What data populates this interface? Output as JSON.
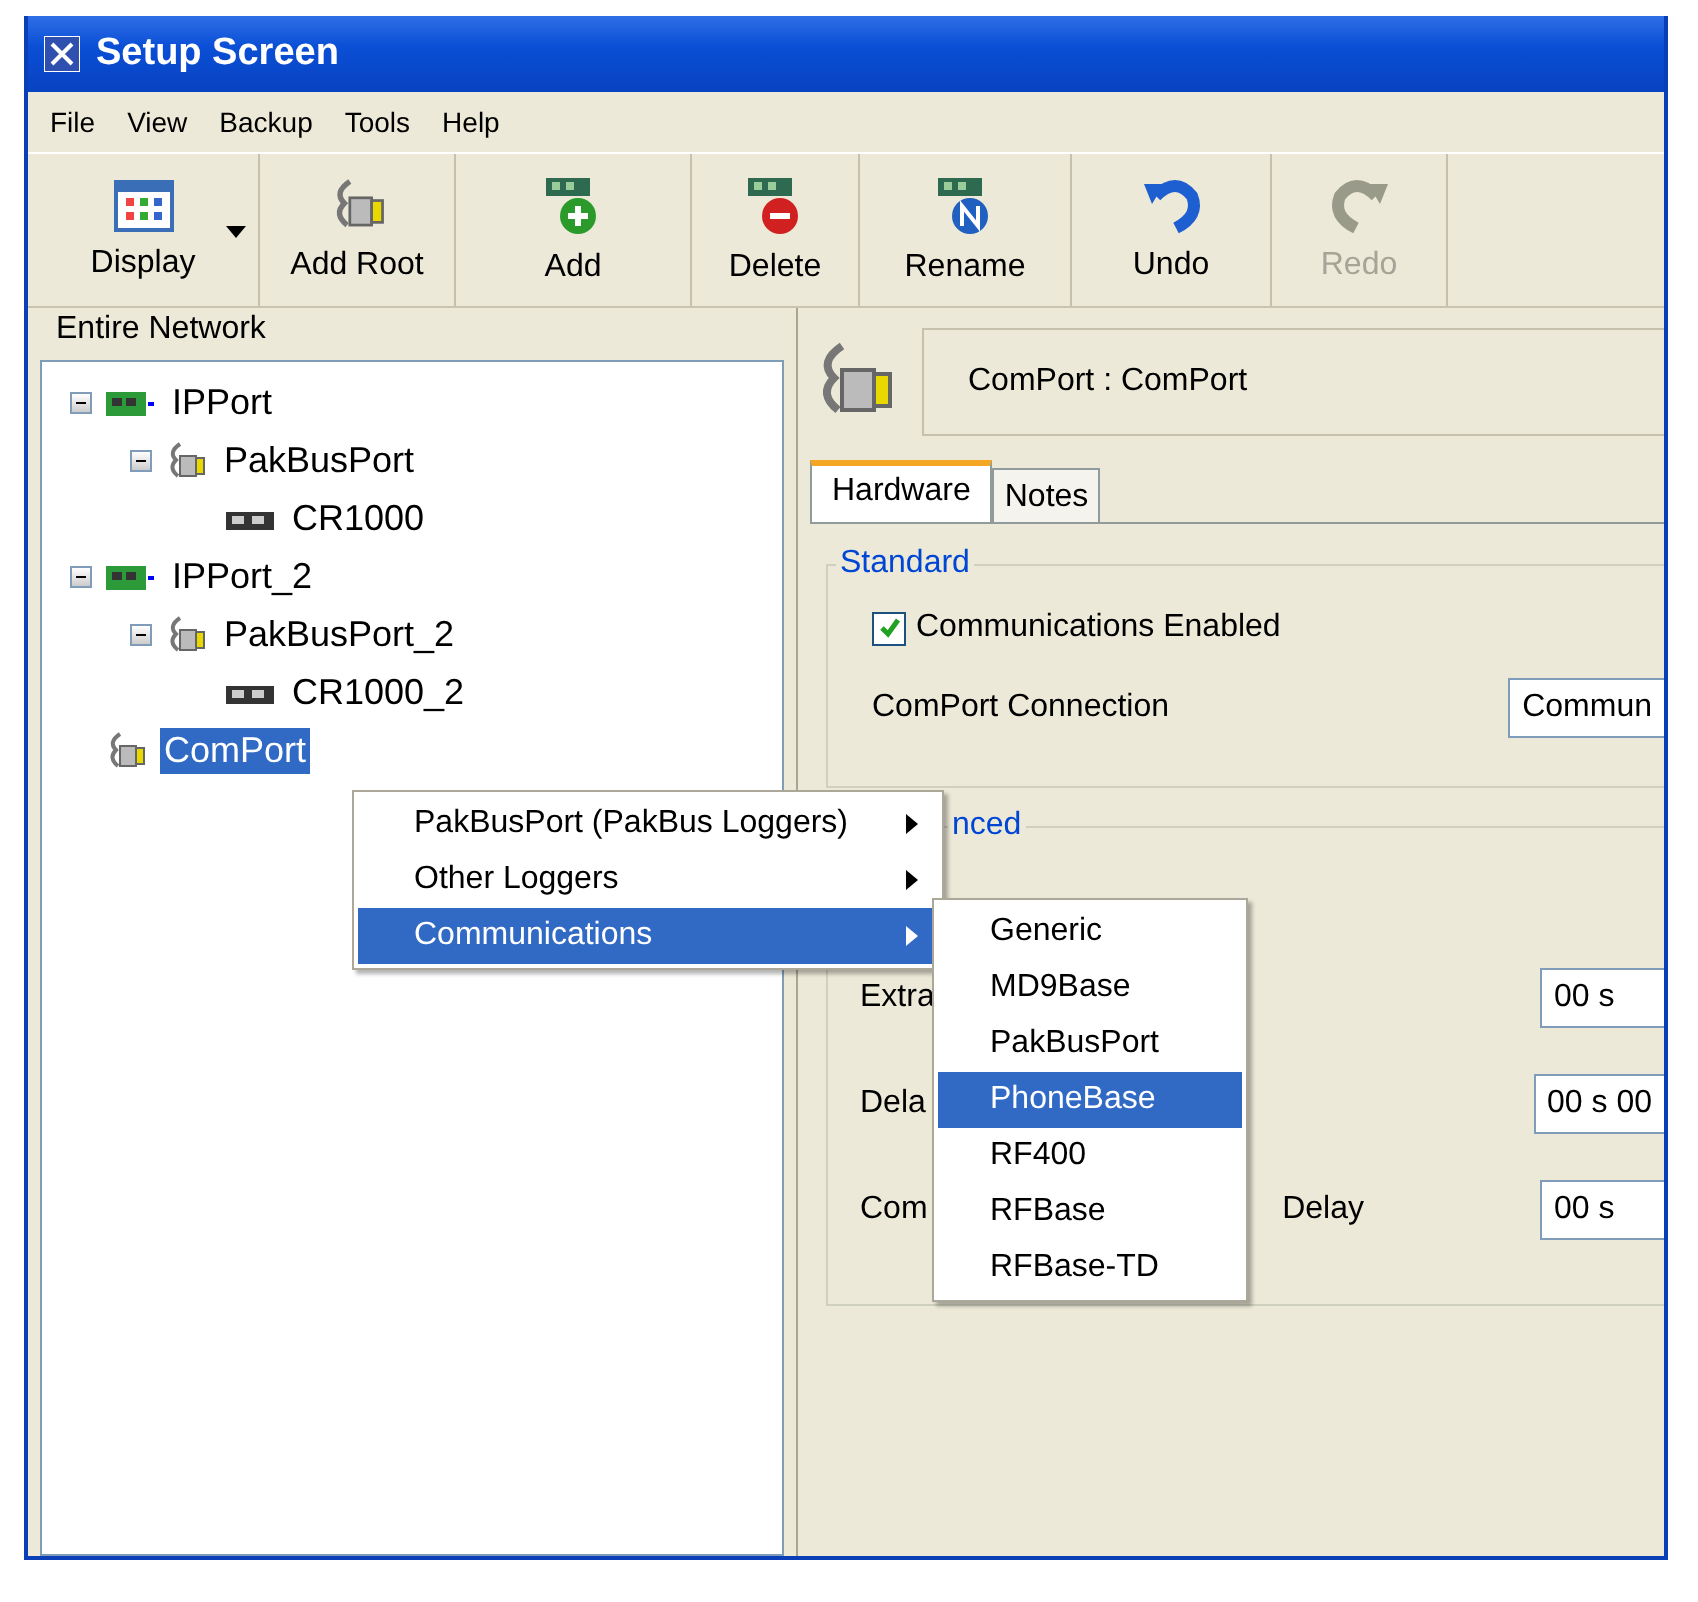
{
  "window": {
    "title": "Setup Screen"
  },
  "menu_bar": [
    "File",
    "View",
    "Backup",
    "Tools",
    "Help"
  ],
  "toolbar": [
    {
      "label": "Display",
      "kind": "display",
      "disabled": false,
      "dropdown": true
    },
    {
      "label": "Add Root",
      "kind": "port",
      "disabled": false,
      "dropdown": false
    },
    {
      "label": "Add",
      "kind": "add",
      "disabled": false,
      "dropdown": false
    },
    {
      "label": "Delete",
      "kind": "delete",
      "disabled": false,
      "dropdown": false
    },
    {
      "label": "Rename",
      "kind": "rename",
      "disabled": false,
      "dropdown": false
    },
    {
      "label": "Undo",
      "kind": "undo",
      "disabled": false,
      "dropdown": false
    },
    {
      "label": "Redo",
      "kind": "redo",
      "disabled": true,
      "dropdown": false
    }
  ],
  "tree": {
    "title": "Entire Network",
    "items": [
      {
        "label": "IPPort",
        "kind": "ip",
        "expanded": true,
        "selected": false,
        "children": [
          {
            "label": "PakBusPort",
            "kind": "port",
            "expanded": true,
            "selected": false,
            "children": [
              {
                "label": "CR1000",
                "kind": "logger",
                "selected": false
              }
            ]
          }
        ]
      },
      {
        "label": "IPPort_2",
        "kind": "ip",
        "expanded": true,
        "selected": false,
        "children": [
          {
            "label": "PakBusPort_2",
            "kind": "port",
            "expanded": true,
            "selected": false,
            "children": [
              {
                "label": "CR1000_2",
                "kind": "logger",
                "selected": false
              }
            ]
          }
        ]
      },
      {
        "label": "ComPort",
        "kind": "port",
        "selected": true
      }
    ]
  },
  "details": {
    "header": "ComPort : ComPort",
    "tabs": [
      {
        "label": "Hardware",
        "selected": true
      },
      {
        "label": "Notes",
        "selected": false
      }
    ],
    "standard": {
      "legend": "Standard",
      "communications_enabled": {
        "label": "Communications Enabled",
        "checked": true
      },
      "connection": {
        "label": "ComPort Connection",
        "value": "Commun"
      }
    },
    "advanced": {
      "legend": "nced",
      "rows": [
        {
          "label": "Extra",
          "value": "00 s"
        },
        {
          "label": "Dela",
          "value": "00 s 00"
        },
        {
          "label": "Com",
          "label_2": "Delay",
          "value": "00 s"
        }
      ]
    }
  },
  "context_menu": [
    {
      "label": "PakBusPort (PakBus Loggers)",
      "selected": false
    },
    {
      "label": "Other Loggers",
      "selected": false
    },
    {
      "label": "Communications",
      "selected": true
    }
  ],
  "submenu": [
    {
      "label": "Generic",
      "selected": false
    },
    {
      "label": "MD9Base",
      "selected": false
    },
    {
      "label": "PakBusPort",
      "selected": false
    },
    {
      "label": "PhoneBase",
      "selected": true
    },
    {
      "label": "RF400",
      "selected": false
    },
    {
      "label": "RFBase",
      "selected": false
    },
    {
      "label": "RFBase-TD",
      "selected": false
    }
  ]
}
